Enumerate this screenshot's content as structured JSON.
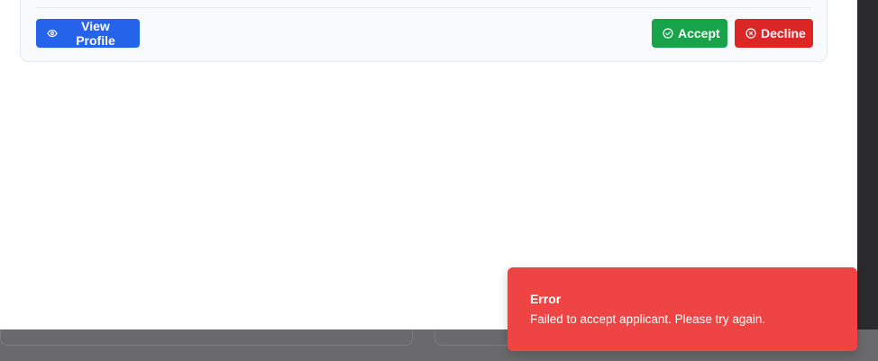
{
  "applicant_card": {
    "view_profile_label": "View Profile",
    "accept_label": "Accept",
    "decline_label": "Decline",
    "icons": {
      "view_profile": "eye-icon",
      "accept": "check-circle-icon",
      "decline": "x-circle-icon"
    }
  },
  "toast": {
    "title": "Error",
    "description": "Failed to accept applicant. Please try again.",
    "variant": "destructive",
    "color": "#ef4444"
  },
  "colors": {
    "primary": "#2563eb",
    "success": "#16a34a",
    "danger": "#dc2626"
  }
}
